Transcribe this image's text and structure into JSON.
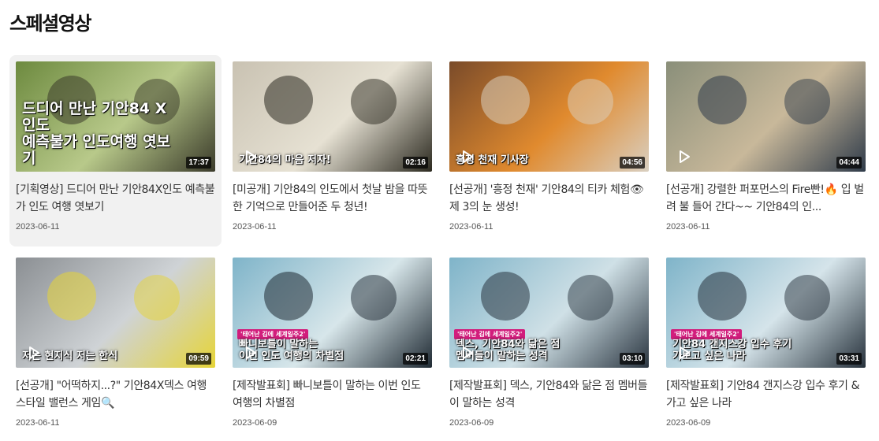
{
  "section": {
    "title": "스페셜영상"
  },
  "videos": [
    {
      "title": "[기획영상] 드디어 만난 기안84X인도 예측불가 인도 여행 엿보기",
      "date": "2023-06-11",
      "duration": "17:37",
      "caption": "드디어 만난 기안84 X 인도\n예측불가 인도여행 엿보기",
      "tag": "",
      "colors": {
        "a": "#6d8a3f",
        "b": "#b8c98a",
        "c": "#3a3a2a"
      },
      "active": true
    },
    {
      "title": "[미공개] 기안84의 인도에서 첫날 밤을 따뜻한 기억으로 만들어준 두 청년!",
      "date": "2023-06-11",
      "duration": "02:16",
      "caption": "기안84의 마음 저자!",
      "tag": "",
      "colors": {
        "a": "#c9c2b2",
        "b": "#e6e1d3",
        "c": "#2c2a20"
      }
    },
    {
      "title": "[선공개] '흥정 천재' 기안84의 티카 체험👁 제 3의 눈 생성!",
      "date": "2023-06-11",
      "duration": "04:56",
      "caption": "흥정 천재 기사장",
      "tag": "",
      "colors": {
        "a": "#7a4b2a",
        "b": "#e08a2e",
        "c": "#d9cfc0"
      }
    },
    {
      "title": "[선공개] 강렬한 퍼포먼스의 Fire빤!🔥 입 벌려 불 들어 간다~~ 기안84의 인...",
      "date": "2023-06-11",
      "duration": "04:44",
      "caption": "",
      "tag": "",
      "colors": {
        "a": "#8a8f7a",
        "b": "#c8b89a",
        "c": "#2f3b4a"
      }
    },
    {
      "title": "[선공개] \"어떡하지...?\" 기안84X덱스 여행 스타일 밸런스 게임🔍",
      "date": "2023-06-11",
      "duration": "09:59",
      "caption": "저는 현지식    저는 한식",
      "tag": "",
      "colors": {
        "a": "#8b8f93",
        "b": "#cfd3d6",
        "c": "#e6d437"
      }
    },
    {
      "title": "[제작발표회] 빠니보틀이 말하는 이번 인도 여행의 차별점",
      "date": "2023-06-09",
      "duration": "02:21",
      "caption": "빠니보틀이 말하는\n이번 인도 여행의 차별점",
      "tag": "'태어난 김에 세계일주2'",
      "colors": {
        "a": "#7fb4c9",
        "b": "#d7e6ea",
        "c": "#1f2a33"
      }
    },
    {
      "title": "[제작발표회] 덱스, 기안84와 닮은 점 멤버들이 말하는 성격",
      "date": "2023-06-09",
      "duration": "03:10",
      "caption": "덱스, 기안84와 닮은 점\n멤버들이 말하는 성격",
      "tag": "'태어난 김에 세계일주2'",
      "colors": {
        "a": "#7fb4c9",
        "b": "#cfe0e6",
        "c": "#2a3540"
      }
    },
    {
      "title": "[제작발표회] 기안84 갠지스강 입수 후기 & 가고 싶은 나라",
      "date": "2023-06-09",
      "duration": "03:31",
      "caption": "기안84 갠지스강 입수 후기\n가보고 싶은 나라",
      "tag": "'태어난 김에 세계일주2'",
      "colors": {
        "a": "#7fb4c9",
        "b": "#d5e4ea",
        "c": "#27323c"
      }
    }
  ]
}
